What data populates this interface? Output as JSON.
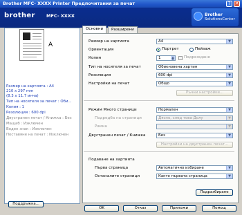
{
  "window": {
    "title": "Brother  MFC-  XXXX    Printer Предпочитания за печат",
    "help_glyph": "?",
    "close_glyph": "✕"
  },
  "banner": {
    "brand": "brother",
    "model": "MFC-  XXXX",
    "solutions_line1": "Brother",
    "solutions_line2": "SolutionsCenter"
  },
  "preview": {
    "letter": "A"
  },
  "summary": [
    {
      "text": "Размер на хартията : A4",
      "style": "blue"
    },
    {
      "text": "210 x 297 mm",
      "style": "blue"
    },
    {
      "text": "(8.3 x 11.7 инча)",
      "style": "blue"
    },
    {
      "text": "Тип на носителя за печат : Оби...",
      "style": "blue"
    },
    {
      "text": "Копия : 1",
      "style": "blue"
    },
    {
      "text": "Резолюция : 600 dpi",
      "style": "blue"
    },
    {
      "text": "Двустранен печат / Книжка : Без",
      "style": "gray"
    },
    {
      "text": "Мащаб : Изключен",
      "style": "gray"
    },
    {
      "text": "Воден знак : Изключен",
      "style": "gray"
    },
    {
      "text": "Поставяне на печат : Изключен",
      "style": "gray"
    }
  ],
  "support_button": "Поддръжка...",
  "tabs": [
    "Основни",
    "Разширени"
  ],
  "form": {
    "paper_size_label": "Размер на хартията",
    "paper_size_value": "A4",
    "orientation_label": "Ориентация",
    "portrait": "Портрет",
    "landscape": "Пейзаж",
    "copies_label": "Копия",
    "copies_value": "1",
    "collate_label": "Подреждане",
    "media_type_label": "Тип на носителя за печат",
    "media_type_value": "Обикновена хартия",
    "resolution_label": "Резолюция",
    "resolution_value": "600 dpi",
    "print_settings_label": "Настройки на печат",
    "print_settings_value": "Общо",
    "manual_settings_button": "Ръчни настройки...",
    "multipage_label": "Режим Много страници",
    "multipage_value": "Нормален",
    "page_order_label": "Подредба на страници",
    "page_order_value": "Дясно, след това Долу",
    "border_label": "Рамка",
    "duplex_label": "Двустранен печат / Книжка",
    "duplex_value": "Без",
    "duplex_settings_button": "Настройки на двустранен печат...",
    "paper_source_label": "Подаване на хартията",
    "first_page_label": "Първа страница",
    "first_page_value": "Автоматично избиране",
    "other_pages_label": "Останалите страници",
    "other_pages_value": "Както първата страница",
    "default_button": "Подразбиране"
  },
  "buttons": {
    "ok": "OK",
    "cancel": "Отказ",
    "apply": "Приложи",
    "help": "Помощ"
  }
}
